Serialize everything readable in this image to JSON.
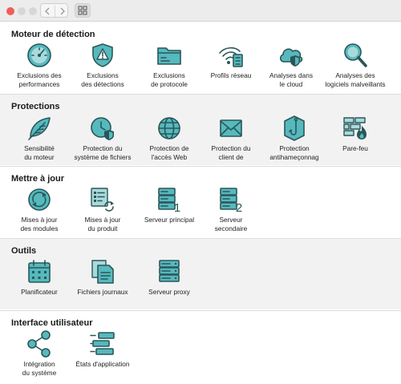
{
  "window": {
    "traffic_lights": [
      "close",
      "minimize",
      "maximize"
    ],
    "nav_back_icon": "chevron-left-icon",
    "nav_forward_icon": "chevron-right-icon",
    "show_all_icon": "grid-icon"
  },
  "colors": {
    "icon_fill": "#56b9bd",
    "icon_stroke": "#2a5659",
    "section_alt_bg": "#f2f2f2",
    "close_light": "#ee5f58"
  },
  "sections": [
    {
      "title": "Moteur de détection",
      "items": [
        {
          "label": "Exclusions des\nperformances",
          "icon": "gauge-icon"
        },
        {
          "label": "Exclusions\ndes détections",
          "icon": "warning-shield-icon"
        },
        {
          "label": "Exclusions\nde protocole",
          "icon": "folder-icon"
        },
        {
          "label": "Profils réseau",
          "icon": "wifi-profile-icon"
        },
        {
          "label": "Analyses dans\nle cloud",
          "icon": "cloud-shield-icon"
        },
        {
          "label": "Analyses des\nlogiciels malveillants",
          "icon": "magnifier-icon"
        }
      ]
    },
    {
      "title": "Protections",
      "items": [
        {
          "label": "Sensibilité\ndu moteur",
          "icon": "feather-icon"
        },
        {
          "label": "Protection du\nsystème de fichiers",
          "icon": "clock-shield-icon"
        },
        {
          "label": "Protection de\nl'accès Web",
          "icon": "globe-icon"
        },
        {
          "label": "Protection du\nclient de",
          "icon": "envelope-icon"
        },
        {
          "label": "Protection\nantihameçonnag",
          "icon": "hook-icon"
        },
        {
          "label": "Pare-feu",
          "icon": "firewall-icon"
        }
      ]
    },
    {
      "title": "Mettre à jour",
      "items": [
        {
          "label": "Mises à jour\ndes modules",
          "icon": "refresh-icon"
        },
        {
          "label": "Mises à jour\ndu produit",
          "icon": "product-update-icon"
        },
        {
          "label": "Serveur principal",
          "icon": "server-primary-icon",
          "badge": "1"
        },
        {
          "label": "Serveur\nsecondaire",
          "icon": "server-secondary-icon",
          "badge": "2"
        }
      ]
    },
    {
      "title": "Outils",
      "items": [
        {
          "label": "Planificateur",
          "icon": "calendar-icon"
        },
        {
          "label": "Fichiers journaux",
          "icon": "log-files-icon"
        },
        {
          "label": "Serveur proxy",
          "icon": "proxy-server-icon"
        }
      ]
    },
    {
      "title": "Interface utilisateur",
      "items": [
        {
          "label": "Intégration\ndu système",
          "icon": "share-nodes-icon"
        },
        {
          "label": "États d'application",
          "icon": "app-states-icon"
        }
      ]
    }
  ]
}
